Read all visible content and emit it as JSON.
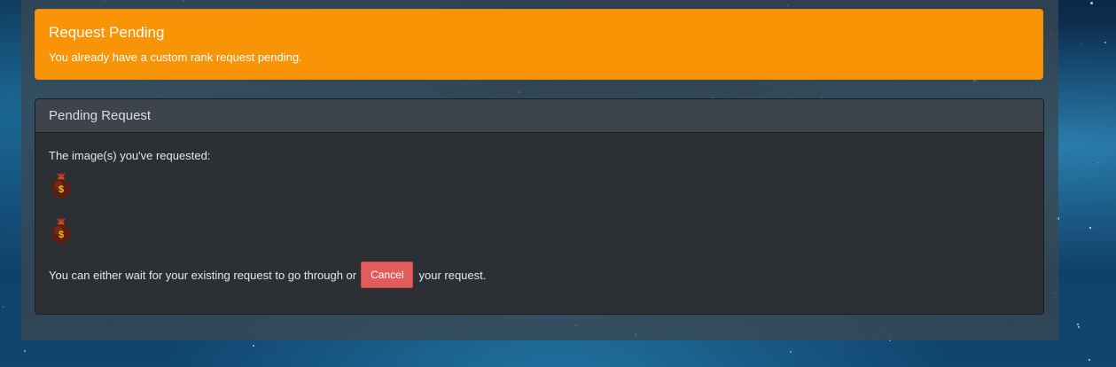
{
  "alert": {
    "title": "Request Pending",
    "message": "You already have a custom rank request pending.",
    "color": "#f89406"
  },
  "panel": {
    "heading": "Pending Request",
    "requested_label": "The image(s) you've requested:",
    "images": [
      {
        "icon": "money-bag-icon"
      },
      {
        "icon": "money-bag-icon"
      }
    ],
    "footer_before": "You can either wait for your existing request to go through or",
    "cancel_label": "Cancel",
    "footer_after": "your request.",
    "cancel_color": "#e35c5c"
  }
}
